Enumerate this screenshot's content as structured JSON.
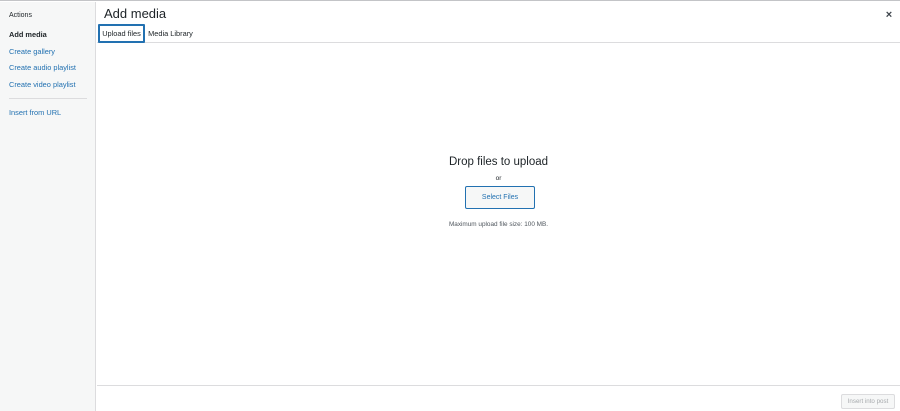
{
  "sidebar": {
    "heading": "Actions",
    "items": [
      {
        "label": "Add media"
      },
      {
        "label": "Create gallery"
      },
      {
        "label": "Create audio playlist"
      },
      {
        "label": "Create video playlist"
      },
      {
        "label": "Insert from URL"
      }
    ]
  },
  "header": {
    "title": "Add media",
    "close_icon": "×"
  },
  "tabs": [
    {
      "label": "Upload files",
      "active": true
    },
    {
      "label": "Media Library",
      "active": false
    }
  ],
  "uploader": {
    "drop_title": "Drop files to upload",
    "or_text": "or",
    "select_button_label": "Select Files",
    "max_size_text": "Maximum upload file size: 100 MB."
  },
  "footer": {
    "insert_button_label": "Insert into post"
  },
  "colors": {
    "link": "#2271b1",
    "sidebar_bg": "#f6f7f7",
    "border": "#dcdcde"
  }
}
